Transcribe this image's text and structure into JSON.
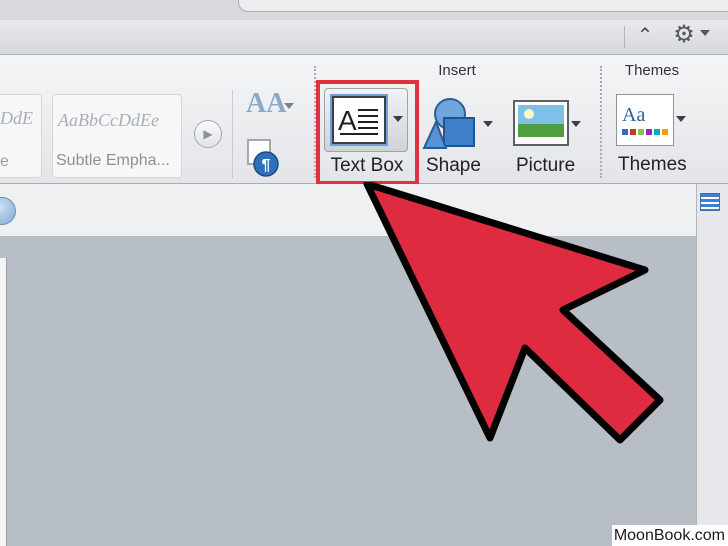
{
  "ribbon": {
    "groups": {
      "insert_label": "Insert",
      "themes_label": "Themes"
    },
    "styles_gallery": {
      "items": [
        {
          "sample": "DdE",
          "name": "e"
        },
        {
          "sample": "AaBbCcDdEe",
          "name": "Subtle Empha..."
        }
      ]
    },
    "insert_buttons": {
      "text_box": "Text Box",
      "shape": "Shape",
      "picture": "Picture"
    },
    "themes_button": "Themes",
    "text_effects_glyph": "AA"
  },
  "colors": {
    "highlight": "#e03140",
    "arrow_fill": "#de2b3f",
    "arrow_outline": "#000000"
  },
  "icons": [
    "gear-icon",
    "chevron-up-icon",
    "text-box-icon",
    "shape-icon",
    "picture-icon",
    "themes-icon",
    "paragraph-icon",
    "gallery-next-icon"
  ],
  "watermark": {
    "text": "MoonBook.com"
  }
}
